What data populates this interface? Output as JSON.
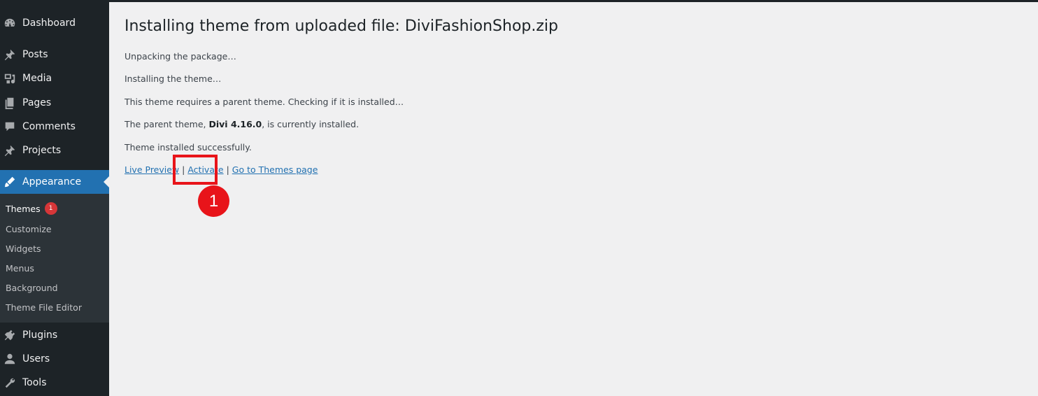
{
  "sidebar": {
    "items_top": [
      {
        "name": "dashboard",
        "label": "Dashboard",
        "icon": "dashboard-icon"
      },
      {
        "name": "posts",
        "label": "Posts",
        "icon": "pin-icon"
      },
      {
        "name": "media",
        "label": "Media",
        "icon": "media-icon"
      },
      {
        "name": "pages",
        "label": "Pages",
        "icon": "pages-icon"
      },
      {
        "name": "comments",
        "label": "Comments",
        "icon": "comment-icon"
      },
      {
        "name": "projects",
        "label": "Projects",
        "icon": "pin-icon"
      }
    ],
    "active": {
      "name": "appearance",
      "label": "Appearance",
      "icon": "brush-icon"
    },
    "submenu": [
      {
        "label": "Themes",
        "badge": "1"
      },
      {
        "label": "Customize"
      },
      {
        "label": "Widgets"
      },
      {
        "label": "Menus"
      },
      {
        "label": "Background"
      },
      {
        "label": "Theme File Editor"
      }
    ],
    "items_bottom": [
      {
        "name": "plugins",
        "label": "Plugins",
        "icon": "plugin-icon"
      },
      {
        "name": "users",
        "label": "Users",
        "icon": "user-icon"
      },
      {
        "name": "tools",
        "label": "Tools",
        "icon": "wrench-icon"
      }
    ]
  },
  "main": {
    "title": "Installing theme from uploaded file: DiviFashionShop.zip",
    "messages": {
      "unpacking": "Unpacking the package…",
      "installing": "Installing the theme…",
      "requires_parent": "This theme requires a parent theme. Checking if it is installed…",
      "parent_prefix": "The parent theme, ",
      "parent_name": "Divi 4.16.0",
      "parent_suffix": ", is currently installed.",
      "success": "Theme installed successfully."
    },
    "links": {
      "live_preview": "Live Preview",
      "separator": "|",
      "activate": "Activate",
      "themes_page": "Go to Themes page"
    }
  },
  "annotation": {
    "step": "1",
    "color": "#e8141a"
  },
  "colors": {
    "sidebar_bg": "#1d2327",
    "submenu_bg": "#2c3338",
    "active_bg": "#2271b1",
    "link": "#2271b1",
    "badge": "#d63638",
    "page_bg": "#f0f0f1"
  }
}
